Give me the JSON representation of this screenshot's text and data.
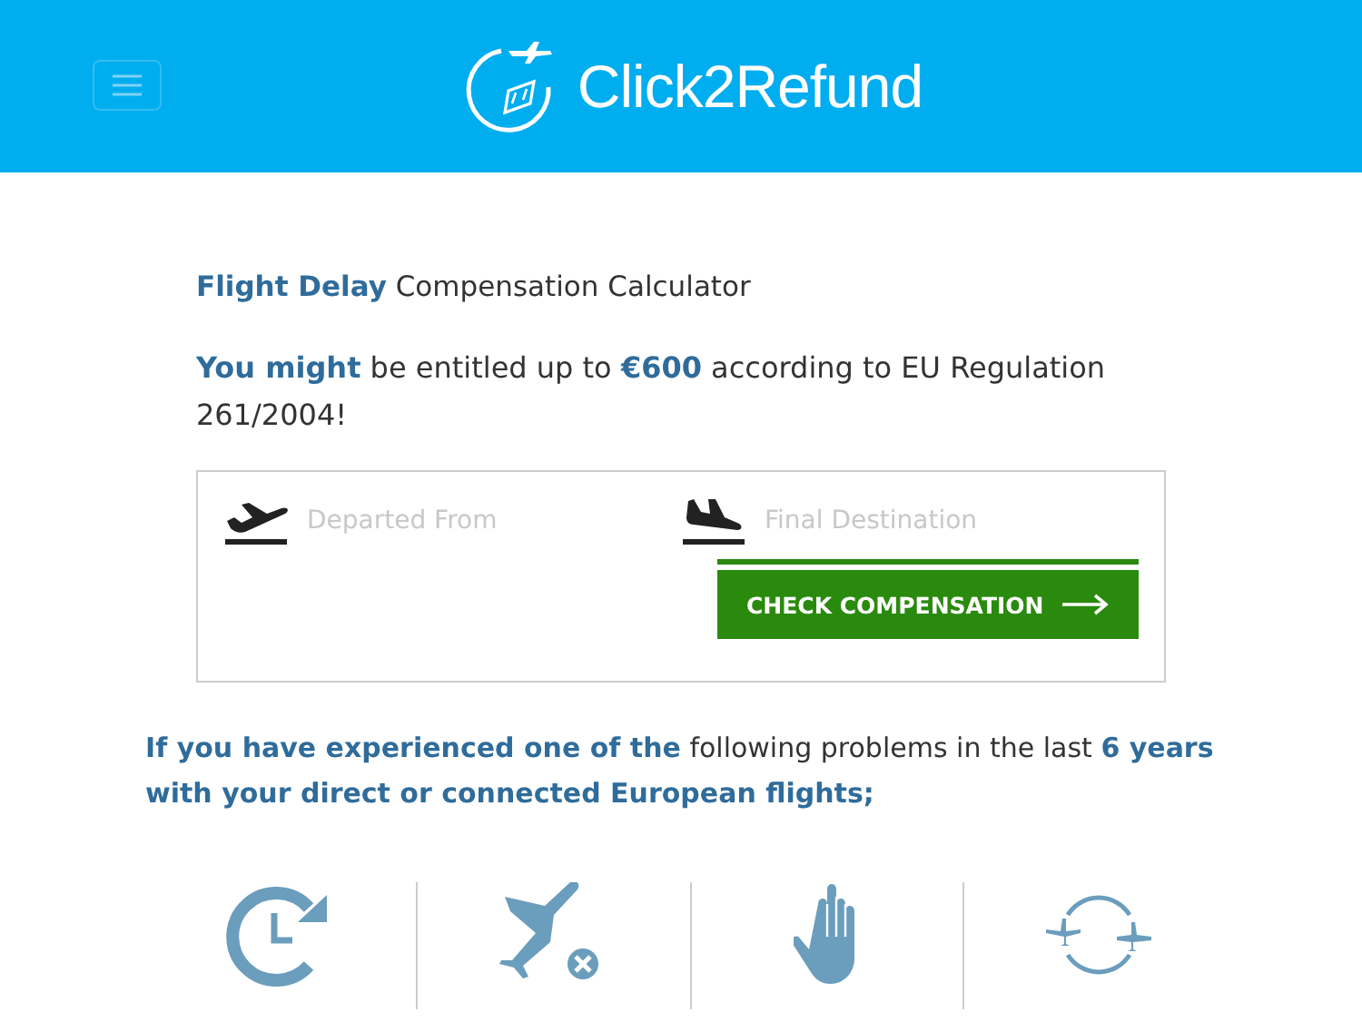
{
  "header": {
    "logo": "Click2Refund"
  },
  "calculator": {
    "title": "**Flight Delay** Compensation Calculator",
    "subtitle": "**You might** be entitled up to **€600** according to EU Regulation 261/2004!",
    "fields": [
      {
        "kind": "departure",
        "placeholder": "Departed From"
      },
      {
        "kind": "arrival",
        "placeholder": "Final Destination"
      }
    ],
    "button": "CHECK COMPENSATION"
  },
  "problems": {
    "intro": "**If you have experienced one of the** following problems in the last **6 years with your direct or connected European flights;**",
    "items": [
      {
        "kind": "delay"
      },
      {
        "kind": "cancelled"
      },
      {
        "kind": "denied"
      },
      {
        "kind": "connection"
      }
    ]
  }
}
